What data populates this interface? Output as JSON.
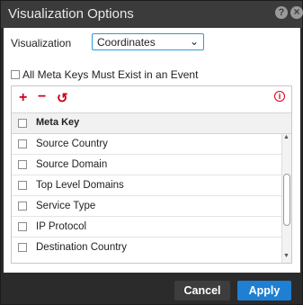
{
  "dialog": {
    "title": "Visualization Options",
    "help_glyph": "?",
    "close_glyph": "×"
  },
  "visualization": {
    "label": "Visualization",
    "selected": "Coordinates",
    "chevron_glyph": "⌄"
  },
  "all_keys": {
    "label": "All Meta Keys Must Exist in an Event",
    "checked": false
  },
  "toolbar": {
    "add_glyph": "+",
    "remove_glyph": "−",
    "undo_glyph": "↺",
    "info_glyph": "i"
  },
  "table": {
    "header": "Meta Key",
    "rows": [
      {
        "label": "Source Country",
        "checked": false
      },
      {
        "label": "Source Domain",
        "checked": false
      },
      {
        "label": "Top Level Domains",
        "checked": false
      },
      {
        "label": "Service Type",
        "checked": false
      },
      {
        "label": "IP Protocol",
        "checked": false
      },
      {
        "label": "Destination Country",
        "checked": false
      }
    ]
  },
  "footer": {
    "cancel_label": "Cancel",
    "apply_label": "Apply"
  },
  "colors": {
    "accent": "#1e7fd3",
    "toolbar_red": "#d0021b",
    "dialog_dark": "#2b2b2b"
  }
}
